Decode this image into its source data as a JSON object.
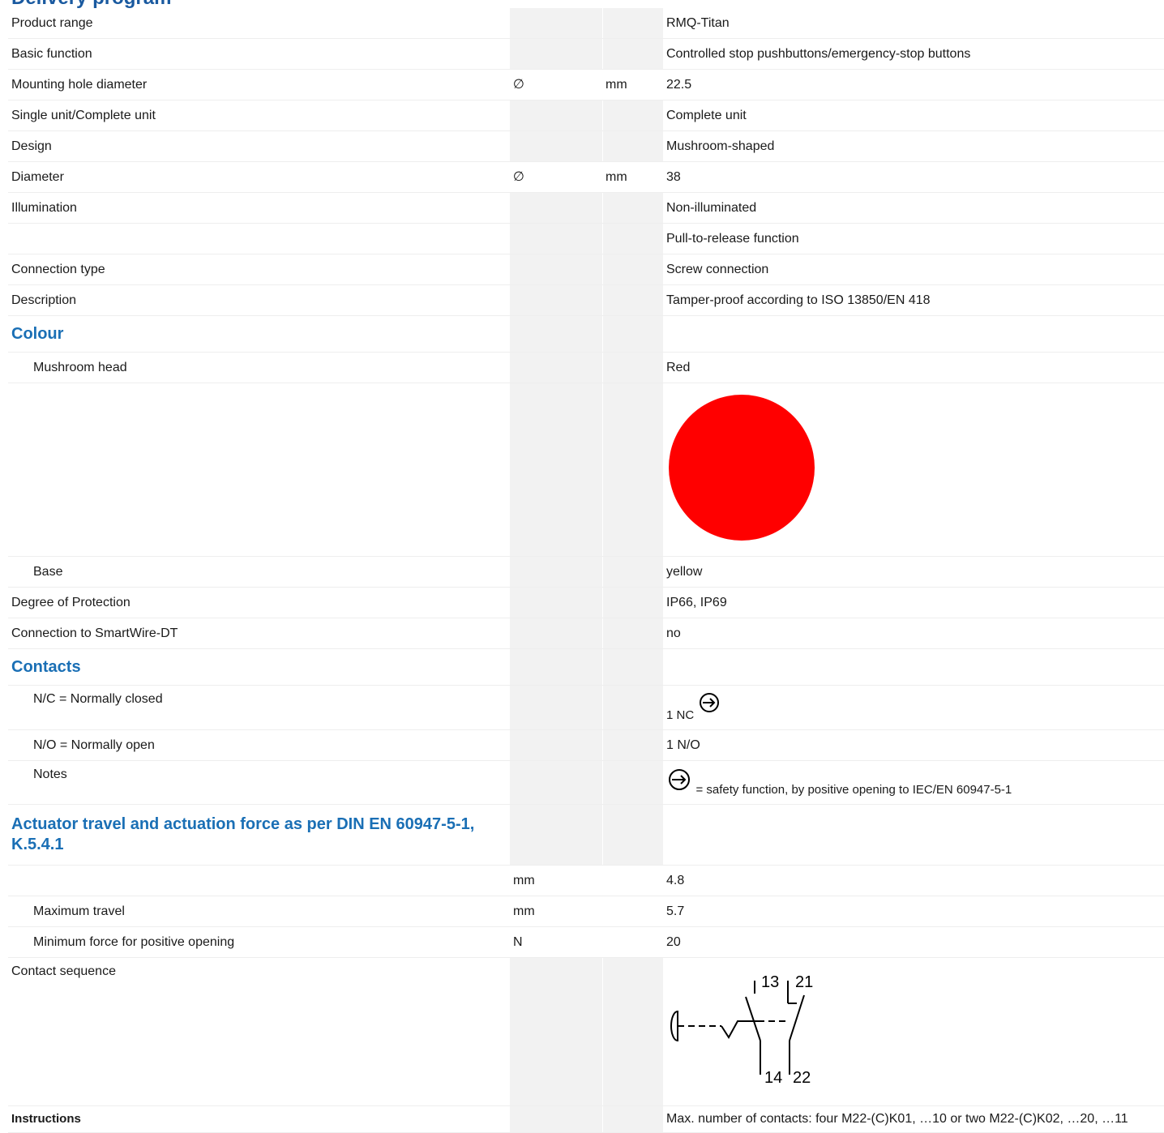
{
  "section_top_title": "Delivery program",
  "rows": {
    "product_range": {
      "label": "Product range",
      "value": "RMQ-Titan"
    },
    "basic_function": {
      "label": "Basic function",
      "value": "Controlled stop pushbuttons/emergency-stop buttons"
    },
    "mounting_hole": {
      "label": "Mounting hole diameter",
      "symbol": "∅",
      "unit": "mm",
      "value": "22.5"
    },
    "single_complete": {
      "label": "Single unit/Complete unit",
      "value": "Complete unit"
    },
    "design": {
      "label": "Design",
      "value": "Mushroom-shaped"
    },
    "diameter": {
      "label": "Diameter",
      "symbol": "∅",
      "unit": "mm",
      "value": "38"
    },
    "illumination": {
      "label": "Illumination",
      "value": "Non-illuminated"
    },
    "pull_release": {
      "label": "",
      "value": "Pull-to-release function"
    },
    "connection_type": {
      "label": "Connection type",
      "value": "Screw connection"
    },
    "description": {
      "label": "Description",
      "value": "Tamper-proof according to ISO 13850/EN 418"
    }
  },
  "colour": {
    "heading": "Colour",
    "mushroom_label": "Mushroom head",
    "mushroom_value": "Red",
    "swatch_color": "#ff0000",
    "base_label": "Base",
    "base_value": "yellow"
  },
  "protection": {
    "label": "Degree of Protection",
    "value": "IP66, IP69"
  },
  "smartwire": {
    "label": "Connection to SmartWire-DT",
    "value": "no"
  },
  "contacts": {
    "heading": "Contacts",
    "nc_label": "N/C = Normally closed",
    "nc_value": "1 NC",
    "no_label": "N/O = Normally open",
    "no_value": "1 N/O",
    "notes_label": "Notes",
    "notes_value": "= safety function, by positive opening to IEC/EN 60947-5-1"
  },
  "actuator": {
    "heading": "Actuator travel and actuation force as per DIN EN 60947-5-1, K.5.4.1",
    "travel_unit": "mm",
    "travel_value": "4.8",
    "max_label": "Maximum travel",
    "max_unit": "mm",
    "max_value": "5.7",
    "force_label": "Minimum force for positive opening",
    "force_unit": "N",
    "force_value": "20"
  },
  "contact_sequence": {
    "label": "Contact sequence",
    "terminals": [
      "13",
      "21",
      "14",
      "22"
    ]
  },
  "instructions": {
    "label": "Instructions",
    "value": "Max. number of contacts: four M22-(C)K01, …10 or two M22-(C)K02, …20, …11"
  }
}
